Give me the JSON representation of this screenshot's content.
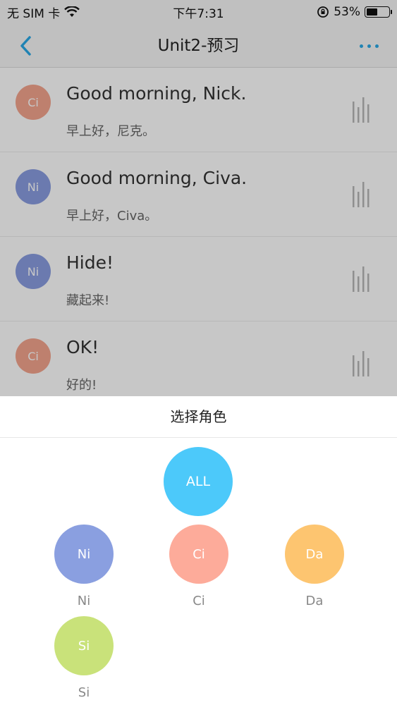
{
  "status_bar": {
    "carrier": "无 SIM 卡",
    "time": "下午7:31",
    "battery_percent": "53%",
    "battery_level": 0.53
  },
  "nav": {
    "title": "Unit2-预习",
    "back_icon": "chevron-left-icon",
    "more_icon": "more-dots-icon",
    "accent_color": "#2aa8e6"
  },
  "dialogue": [
    {
      "avatar": "Ci",
      "color": "#f4a58e",
      "en": "Good morning, Nick.",
      "cn": "早上好，尼克。"
    },
    {
      "avatar": "Ni",
      "color": "#8a9de0",
      "en": "Good morning, Civa.",
      "cn": "早上好，Civa。"
    },
    {
      "avatar": "Ni",
      "color": "#8a9de0",
      "en": "Hide!",
      "cn": "藏起来!"
    },
    {
      "avatar": "Ci",
      "color": "#f4a58e",
      "en": "OK!",
      "cn": "好的!"
    }
  ],
  "sheet": {
    "title": "选择角色",
    "all": {
      "label": "ALL",
      "color": "#4cc9fa"
    },
    "roles": [
      {
        "abbr": "Ni",
        "name": "Ni",
        "color": "#8a9fe0"
      },
      {
        "abbr": "Ci",
        "name": "Ci",
        "color": "#fdab9a"
      },
      {
        "abbr": "Da",
        "name": "Da",
        "color": "#fdc570"
      },
      {
        "abbr": "Si",
        "name": "Si",
        "color": "#c9e27a"
      }
    ]
  }
}
